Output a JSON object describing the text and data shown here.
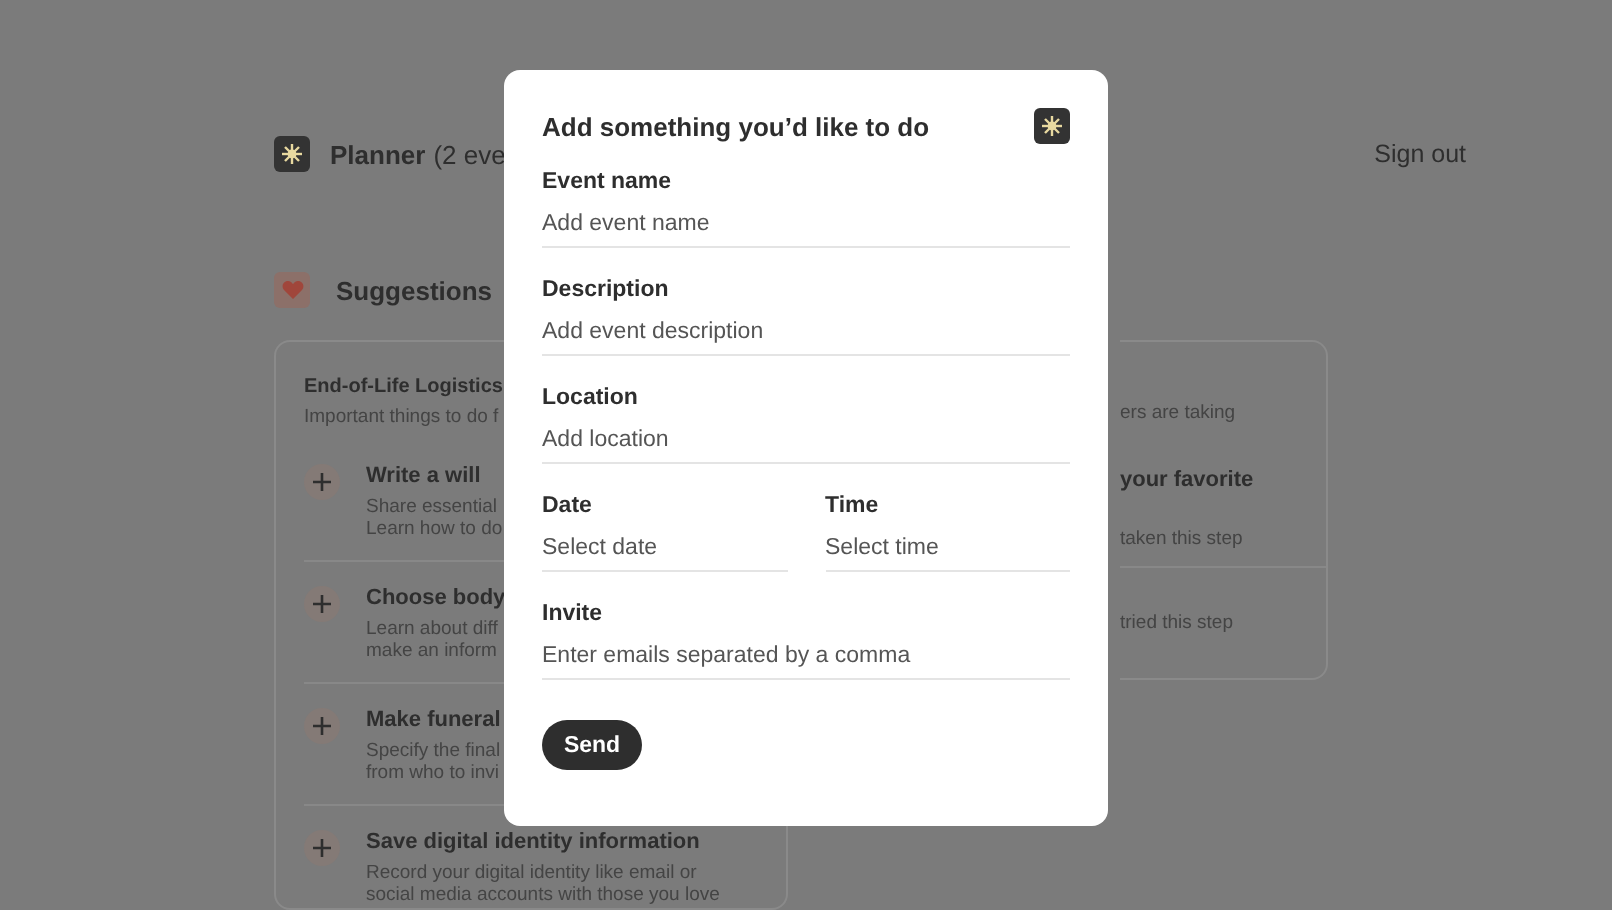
{
  "header": {
    "title": "Planner",
    "count": "(2 eve",
    "sign_out": "Sign out"
  },
  "suggestions": {
    "title": "Suggestions",
    "left_card": {
      "title": "End-of-Life Logistics",
      "subtitle": "Important things to do f",
      "items": [
        {
          "title": "Write a will",
          "description": [
            "Share essential",
            "Learn how to do"
          ]
        },
        {
          "title": "Choose body",
          "description": [
            "Learn about diff",
            "make an inform"
          ]
        },
        {
          "title": "Make funeral",
          "description": [
            "Specify the final",
            "from who to invi"
          ]
        },
        {
          "title": "Save digital identity information",
          "description": [
            "Record your digital identity like email or",
            "social media accounts with those you love"
          ]
        }
      ]
    },
    "right_card": {
      "subtitle": "ers are taking",
      "items": [
        {
          "title": "your favorite",
          "description": "taken this step"
        },
        {
          "description": "tried this step"
        }
      ]
    }
  },
  "modal": {
    "title": "Add something you’d like to do",
    "fields": [
      {
        "kind": "full",
        "label": "Event name",
        "placeholder": "Add event name"
      },
      {
        "kind": "full",
        "label": "Description",
        "placeholder": "Add event description"
      },
      {
        "kind": "full",
        "label": "Location",
        "placeholder": "Add location"
      },
      {
        "kind": "half",
        "label": "Date",
        "placeholder": "Select date"
      },
      {
        "kind": "half",
        "label": "Time",
        "placeholder": "Select time"
      },
      {
        "kind": "full",
        "label": "Invite",
        "placeholder": "Enter emails separated by a comma"
      }
    ],
    "button": "Send"
  }
}
